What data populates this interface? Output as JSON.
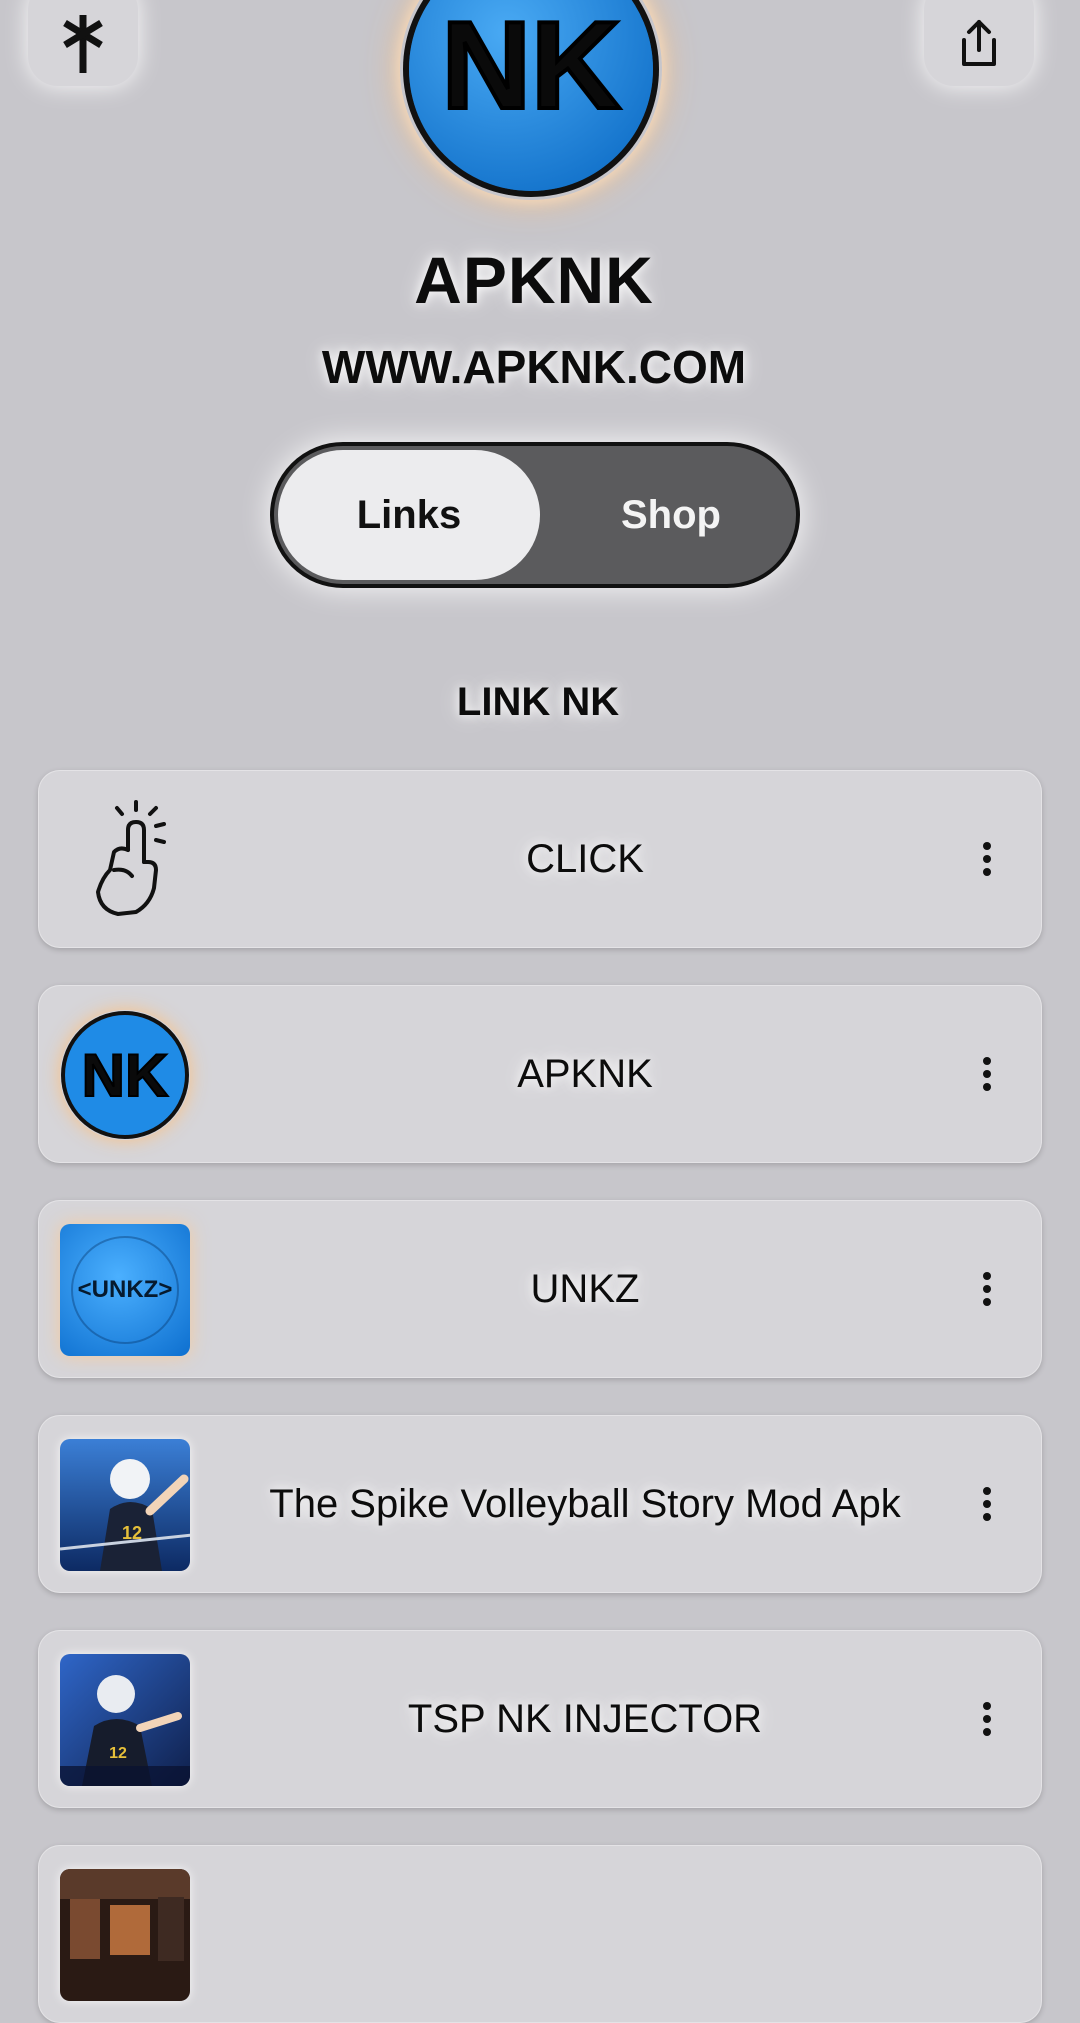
{
  "header": {
    "left_icon": "linktree-asterisk-icon",
    "right_icon": "share-icon",
    "avatar_text": "NK",
    "title": "APKNK",
    "subtitle": "WWW.APKNK.COM"
  },
  "toggle": {
    "links_label": "Links",
    "shop_label": "Shop",
    "selected": "Links"
  },
  "section_title": "LINK NK",
  "links": [
    {
      "label": "CLICK",
      "icon": "pointing-hand-icon"
    },
    {
      "label": "APKNK",
      "icon": "nk-logo-icon"
    },
    {
      "label": "UNKZ",
      "icon": "unkz-logo-icon",
      "icon_text": "<UNKZ>"
    },
    {
      "label": "The Spike Volleyball Story Mod Apk",
      "icon": "volleyball-player-thumbnail"
    },
    {
      "label": "TSP NK INJECTOR",
      "icon": "volleyball-player-thumbnail"
    },
    {
      "label": "",
      "icon": "game-thumbnail"
    }
  ],
  "colors": {
    "background": "#c7c6cb",
    "card": "#d6d5d9",
    "brand_blue": "#1f8be6",
    "toggle_dark": "#5b5b5d"
  }
}
